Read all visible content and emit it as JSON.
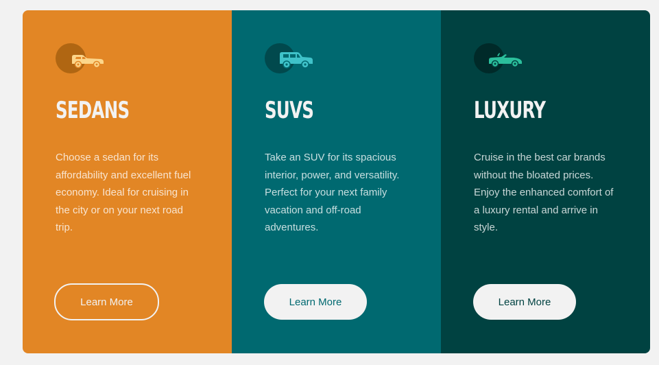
{
  "cards": [
    {
      "title": "SEDANS",
      "description": "Choose a sedan for its affordability and excellent fuel economy. Ideal for cruising in the city or on your next road trip.",
      "button_label": "Learn More",
      "icon": "sedan-car-icon",
      "background": "#e28625",
      "icon_color": "#fcd68a"
    },
    {
      "title": "SUVS",
      "description": "Take an SUV for its spacious interior, power, and versatility. Perfect for your next family vacation and off-road adventures.",
      "button_label": "Learn More",
      "icon": "suv-car-icon",
      "background": "#006970",
      "icon_color": "#3fc2c9"
    },
    {
      "title": "LUXURY",
      "description": "Cruise in the best car brands without the bloated prices. Enjoy the enhanced comfort of a luxury rental and arrive in style.",
      "button_label": "Learn More",
      "icon": "luxury-convertible-icon",
      "background": "#004241",
      "icon_color": "#2bbf9c"
    }
  ],
  "colors": {
    "page_background": "#f2f2f2",
    "text_light": "#f2f2f2"
  }
}
